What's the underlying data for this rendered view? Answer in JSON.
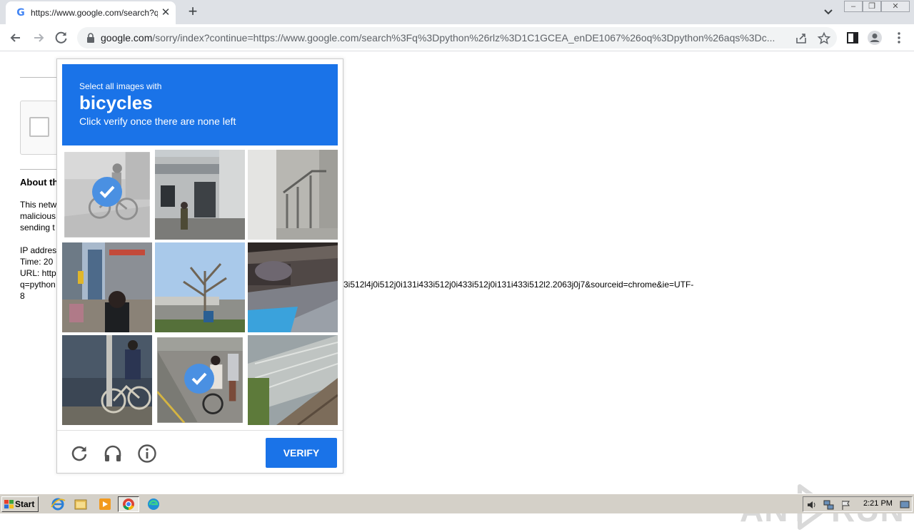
{
  "tab": {
    "favicon": "G",
    "title": "https://www.google.com/search?q=",
    "close": "✕",
    "new_tab": "+"
  },
  "window_controls": {
    "minimize": "–",
    "maximize": "❐",
    "close": "✕"
  },
  "address_bar": {
    "host": "google.com",
    "path": "/sorry/index?continue=https://www.google.com/search%3Fq%3Dpython%26rlz%3D1C1GCEA_enDE1067%26oq%3Dpython%26aqs%3Dc..."
  },
  "page": {
    "about_heading": "About th",
    "para1": [
      "This netw",
      "malicious",
      "sending t"
    ],
    "info": [
      "IP addres",
      "Time: 20",
      "URL: http",
      "q=python"
    ],
    "info_tail": "3i512l4j0i512j0i131i433i512j0i433i512j0i131i433i512l2.2063j0j7&sourceid=chrome&ie=UTF-",
    "info_last": "8"
  },
  "captcha": {
    "instruction": "Select all images with",
    "target": "bicycles",
    "hint": "Click verify once there are none left",
    "verify_label": "VERIFY",
    "tiles": [
      {
        "name": "tile-1",
        "scene": "cyclist",
        "selected": true
      },
      {
        "name": "tile-2",
        "scene": "building",
        "selected": false
      },
      {
        "name": "tile-3",
        "scene": "stairs-rail",
        "selected": false
      },
      {
        "name": "tile-4",
        "scene": "street",
        "selected": false
      },
      {
        "name": "tile-5",
        "scene": "tree",
        "selected": false
      },
      {
        "name": "tile-6",
        "scene": "car-awning",
        "selected": false
      },
      {
        "name": "tile-7",
        "scene": "cyclist-dark",
        "selected": false
      },
      {
        "name": "tile-8",
        "scene": "cyclist-road",
        "selected": true
      },
      {
        "name": "tile-9",
        "scene": "bridge-tube",
        "selected": false
      }
    ]
  },
  "watermark": {
    "left": "ANY",
    "right": "RUN"
  },
  "taskbar": {
    "start_label": "Start",
    "clock": "2:21 PM",
    "apps": [
      "internet-explorer-icon",
      "file-explorer-icon",
      "media-player-icon",
      "chrome-icon",
      "edge-icon"
    ]
  },
  "colors": {
    "accent": "#1a73e8",
    "check": "#4a90e2"
  }
}
